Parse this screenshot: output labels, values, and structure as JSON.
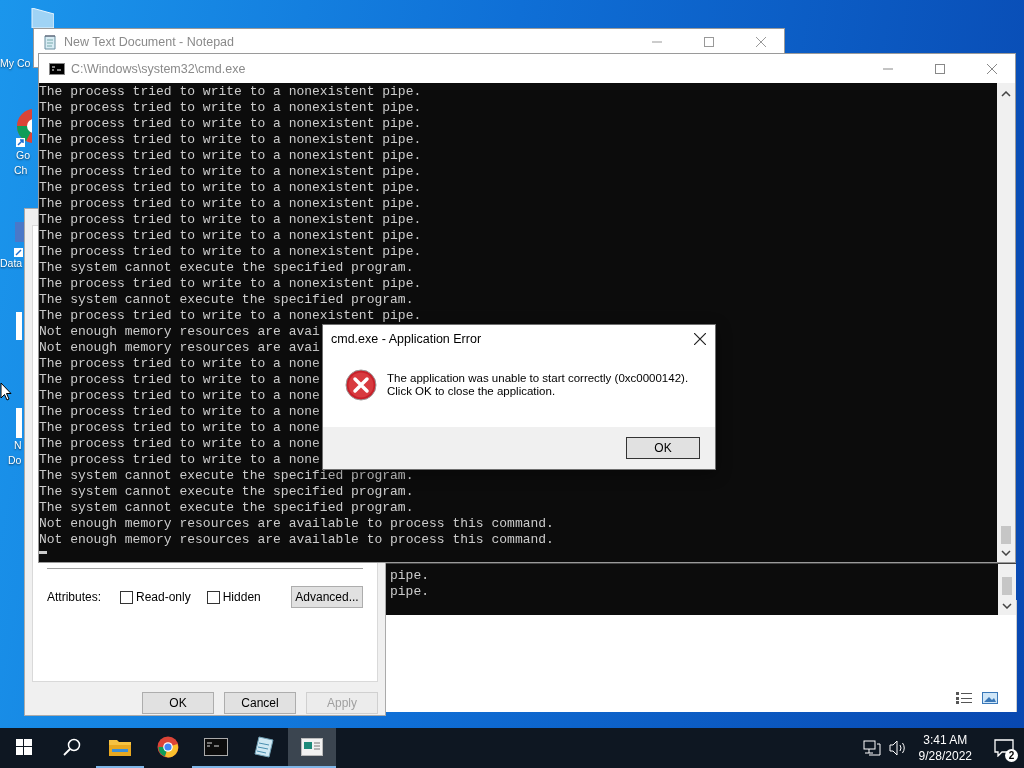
{
  "desktop_icons": [
    {
      "kind": "computer",
      "label_lines": [
        "My Co"
      ]
    },
    {
      "kind": "chrome",
      "label_lines": [
        "Go",
        "Ch"
      ]
    },
    {
      "kind": "data",
      "label_lines": [
        "Data"
      ]
    },
    {
      "kind": "document",
      "label_lines": [
        "N",
        "Do"
      ]
    }
  ],
  "notepad": {
    "title": "New Text Document - Notepad"
  },
  "properties": {
    "attributes_label": "Attributes:",
    "checkboxes": [
      {
        "label": "Read-only",
        "checked": false
      },
      {
        "label": "Hidden",
        "checked": false
      }
    ],
    "advanced_button": "Advanced...",
    "buttons": [
      {
        "label": "OK",
        "disabled": false
      },
      {
        "label": "Cancel",
        "disabled": false
      },
      {
        "label": "Apply",
        "disabled": true
      }
    ]
  },
  "back_console": {
    "lines": [
      "pipe.",
      "pipe."
    ]
  },
  "console": {
    "title": "C:\\Windows\\system32\\cmd.exe",
    "lines": [
      "The process tried to write to a nonexistent pipe.",
      "The process tried to write to a nonexistent pipe.",
      "The process tried to write to a nonexistent pipe.",
      "The process tried to write to a nonexistent pipe.",
      "The process tried to write to a nonexistent pipe.",
      "The process tried to write to a nonexistent pipe.",
      "The process tried to write to a nonexistent pipe.",
      "The process tried to write to a nonexistent pipe.",
      "The process tried to write to a nonexistent pipe.",
      "The process tried to write to a nonexistent pipe.",
      "The process tried to write to a nonexistent pipe.",
      "The system cannot execute the specified program.",
      "The process tried to write to a nonexistent pipe.",
      "The system cannot execute the specified program.",
      "The process tried to write to a nonexistent pipe.",
      "Not enough memory resources are avai",
      "Not enough memory resources are avai",
      "The process tried to write to a none",
      "The process tried to write to a none",
      "The process tried to write to a none",
      "The process tried to write to a none",
      "The process tried to write to a none",
      "The process tried to write to a none",
      "The process tried to write to a none",
      "The system cannot execute the specified program.",
      "The system cannot execute the specified program.",
      "The system cannot execute the specified program.",
      "Not enough memory resources are available to process this command.",
      "Not enough memory resources are available to process this command."
    ]
  },
  "error_dialog": {
    "title": "cmd.exe - Application Error",
    "message": "The application was unable to start correctly (0xc0000142).\nClick OK to close the application.",
    "button": "OK"
  },
  "taskbar": {
    "items": [
      {
        "kind": "start",
        "running": false,
        "selected": false
      },
      {
        "kind": "search",
        "running": false,
        "selected": false
      },
      {
        "kind": "explorer",
        "running": true,
        "selected": false
      },
      {
        "kind": "chrome",
        "running": false,
        "selected": false
      },
      {
        "kind": "cmd",
        "running": true,
        "selected": false
      },
      {
        "kind": "notepad",
        "running": true,
        "selected": false
      },
      {
        "kind": "properties",
        "running": true,
        "selected": true
      }
    ],
    "time": "3:41 AM",
    "date": "9/28/2022",
    "notification_count": "2"
  }
}
